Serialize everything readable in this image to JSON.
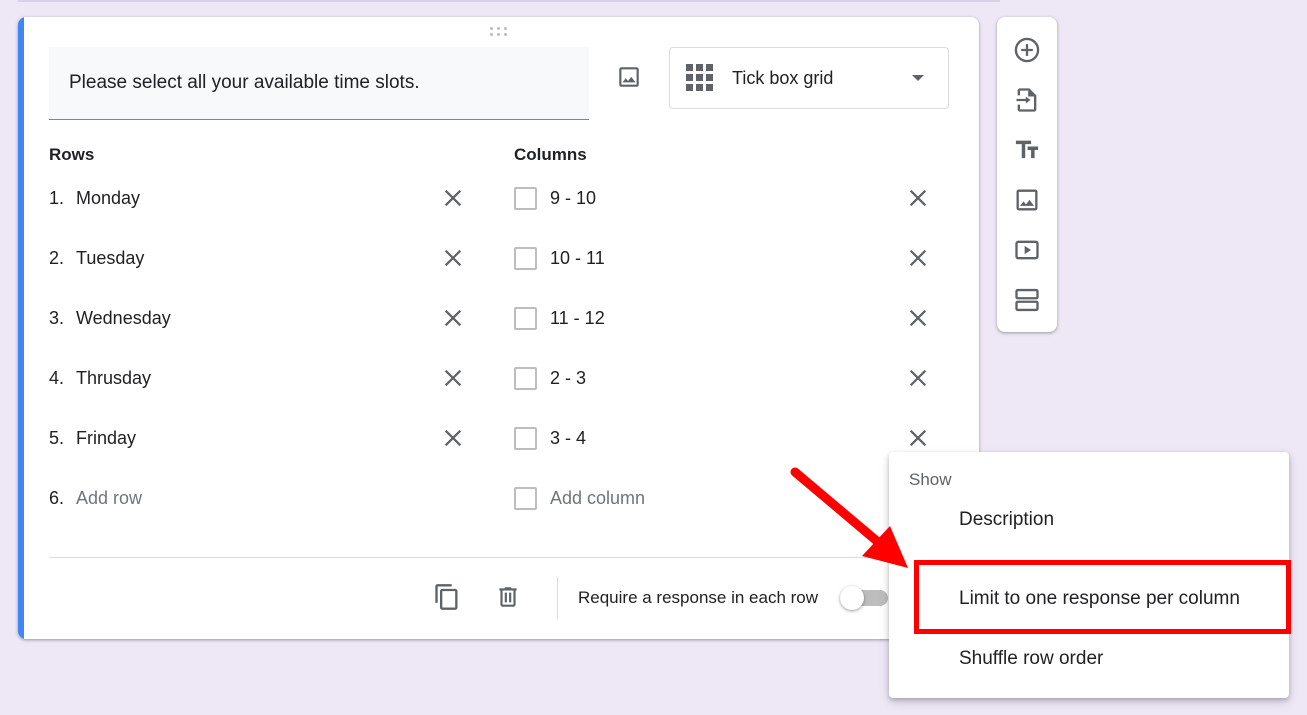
{
  "question": {
    "title": "Please select all your available time slots.",
    "type_label": "Tick box grid"
  },
  "rows": {
    "heading": "Rows",
    "items": [
      {
        "num": "1.",
        "label": "Monday"
      },
      {
        "num": "2.",
        "label": "Tuesday"
      },
      {
        "num": "3.",
        "label": "Wednesday"
      },
      {
        "num": "4.",
        "label": "Thrusday"
      },
      {
        "num": "5.",
        "label": "Frinday"
      }
    ],
    "add": {
      "num": "6.",
      "label": "Add row"
    }
  },
  "columns": {
    "heading": "Columns",
    "items": [
      "9 - 10",
      "10 - 11",
      "11 - 12",
      "2 - 3",
      "3 - 4"
    ],
    "add": "Add column"
  },
  "footer": {
    "require_label": "Require a response in each row",
    "require_on": false
  },
  "menu": {
    "header": "Show",
    "items": [
      "Description",
      "Limit to one response per column",
      "Shuffle row order"
    ],
    "highlighted_index": 1
  },
  "colors": {
    "accent": "#4285f4",
    "annotation": "#ff0000",
    "background": "#ede7f6"
  },
  "icons": {
    "toolbar": [
      "add-circle-icon",
      "import-icon",
      "title-icon",
      "image-icon",
      "video-icon",
      "section-icon"
    ]
  }
}
